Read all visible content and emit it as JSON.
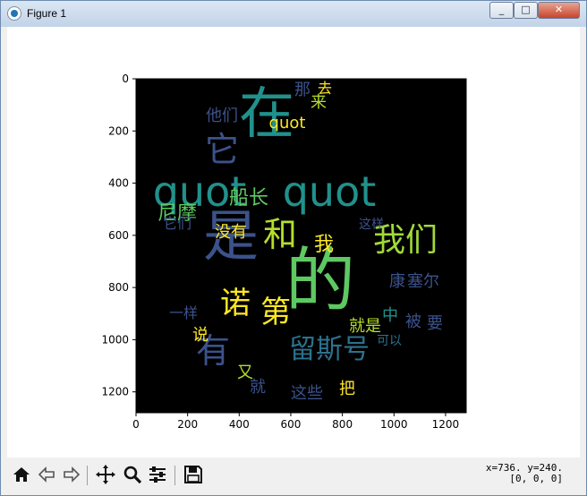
{
  "window": {
    "title": "Figure 1",
    "buttons": [
      "_",
      "□",
      "✕"
    ]
  },
  "axes": {
    "xticks": [
      "0",
      "200",
      "400",
      "600",
      "800",
      "1000",
      "1200"
    ],
    "yticks": [
      "0",
      "200",
      "400",
      "600",
      "800",
      "1000",
      "1200"
    ]
  },
  "wordcloud": [
    {
      "t": "的",
      "c": "#5ec962"
    },
    {
      "t": "是",
      "c": "#3b528b"
    },
    {
      "t": "在",
      "c": "#21918c"
    },
    {
      "t": "quot",
      "c": "#21918c"
    },
    {
      "t": "quot",
      "c": "#21918c"
    },
    {
      "t": "我们",
      "c": "#a0da39"
    },
    {
      "t": "和",
      "c": "#b5de2b"
    },
    {
      "t": "它",
      "c": "#3b528b"
    },
    {
      "t": "有",
      "c": "#3b528b"
    },
    {
      "t": "诺",
      "c": "#fde725"
    },
    {
      "t": "第",
      "c": "#fde725"
    },
    {
      "t": "留斯号",
      "c": "#2c728e"
    },
    {
      "t": "尼摩",
      "c": "#5ec962"
    },
    {
      "t": "船长",
      "c": "#5ec962"
    },
    {
      "t": "说",
      "c": "#fde725"
    },
    {
      "t": "我",
      "c": "#fde725"
    },
    {
      "t": "他们",
      "c": "#3b528b"
    },
    {
      "t": "这些",
      "c": "#3b528b"
    },
    {
      "t": "就是",
      "c": "#b5de2b"
    },
    {
      "t": "可以",
      "c": "#2c728e"
    },
    {
      "t": "康",
      "c": "#3b528b"
    },
    {
      "t": "塞尔",
      "c": "#3b528b"
    },
    {
      "t": "没有",
      "c": "#fde725"
    },
    {
      "t": "中",
      "c": "#21918c"
    },
    {
      "t": "被",
      "c": "#3b528b"
    },
    {
      "t": "要",
      "c": "#3b528b"
    },
    {
      "t": "把",
      "c": "#fde725"
    },
    {
      "t": "它们",
      "c": "#3b528b"
    },
    {
      "t": "就",
      "c": "#3b528b"
    },
    {
      "t": "又",
      "c": "#b5de2b"
    },
    {
      "t": "quot",
      "c": "#fde725"
    },
    {
      "t": "那",
      "c": "#3b528b"
    },
    {
      "t": "来",
      "c": "#b5de2b"
    },
    {
      "t": "去",
      "c": "#fde725"
    },
    {
      "t": "这样",
      "c": "#3b528b"
    },
    {
      "t": "一样",
      "c": "#3b528b"
    }
  ],
  "toolbar": {
    "icons": [
      "home-icon",
      "back-icon",
      "forward-icon",
      "pan-icon",
      "zoom-icon",
      "configure-icon",
      "save-icon"
    ]
  },
  "status": {
    "coords": "x=736. y=240.",
    "pixel": "[0, 0, 0]"
  }
}
